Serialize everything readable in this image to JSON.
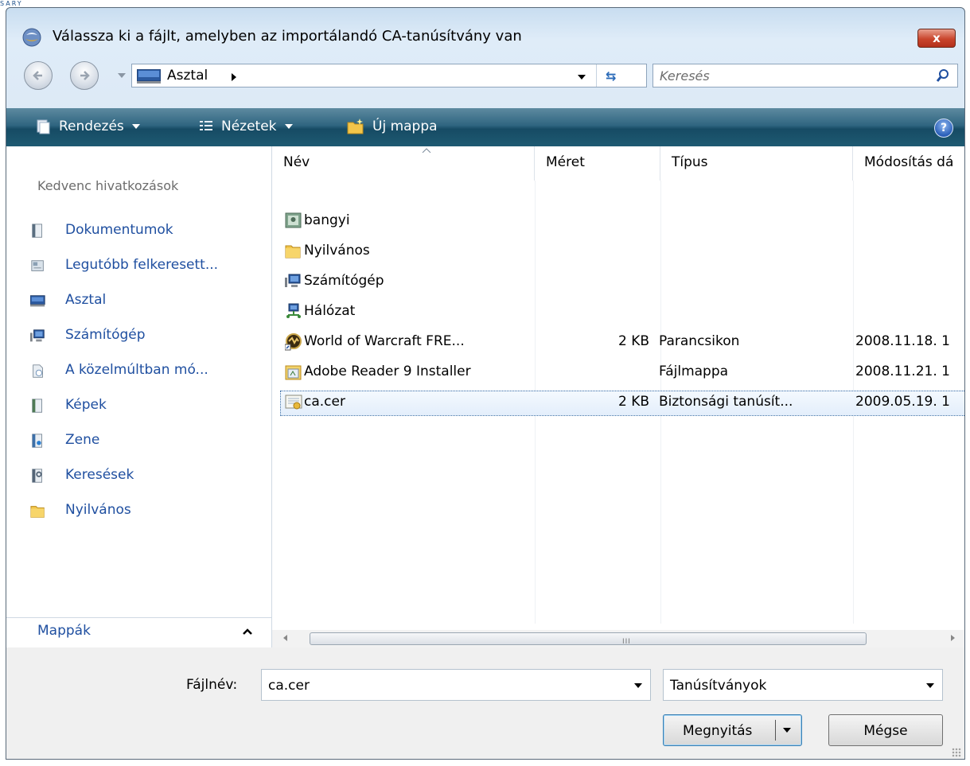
{
  "logo_fragment": "SARY",
  "window": {
    "title": "Válassza ki a fájlt, amelyben az importálandó CA-tanúsítvány van",
    "close_label": "x"
  },
  "address": {
    "crumb": "Asztal",
    "search_placeholder": "Keresés"
  },
  "toolbar": {
    "organize_label": "Rendezés",
    "views_label": "Nézetek",
    "new_folder_label": "Új mappa",
    "help_label": "?"
  },
  "nav": {
    "heading": "Kedvenc hivatkozások",
    "items": [
      {
        "label": "Dokumentumok",
        "icon": "documents-icon"
      },
      {
        "label": "Legutóbb felkeresett...",
        "icon": "recent-places-icon"
      },
      {
        "label": "Asztal",
        "icon": "desktop-icon"
      },
      {
        "label": "Számítógép",
        "icon": "computer-icon"
      },
      {
        "label": "A közelmúltban mó...",
        "icon": "recently-changed-icon"
      },
      {
        "label": "Képek",
        "icon": "pictures-icon"
      },
      {
        "label": "Zene",
        "icon": "music-icon"
      },
      {
        "label": "Keresések",
        "icon": "searches-icon"
      },
      {
        "label": "Nyilvános",
        "icon": "public-folder-icon"
      }
    ],
    "folders_label": "Mappák"
  },
  "columns": {
    "name": "Név",
    "size": "Méret",
    "type": "Típus",
    "modified": "Módosítás dá"
  },
  "files": [
    {
      "name": "bangyi",
      "size": "",
      "type": "",
      "modified": "",
      "icon": "user-folder-icon"
    },
    {
      "name": "Nyilvános",
      "size": "",
      "type": "",
      "modified": "",
      "icon": "folder-icon"
    },
    {
      "name": "Számítógép",
      "size": "",
      "type": "",
      "modified": "",
      "icon": "computer-icon"
    },
    {
      "name": "Hálózat",
      "size": "",
      "type": "",
      "modified": "",
      "icon": "network-icon"
    },
    {
      "name": "World of Warcraft FRE...",
      "size": "2 KB",
      "type": "Parancsikon",
      "modified": "2008.11.18. 1",
      "icon": "wow-shortcut-icon"
    },
    {
      "name": "Adobe Reader 9 Installer",
      "size": "",
      "type": "Fájlmappa",
      "modified": "2008.11.21. 1",
      "icon": "installer-folder-icon"
    },
    {
      "name": "ca.cer",
      "size": "2 KB",
      "type": "Biztonsági tanúsít...",
      "modified": "2009.05.19. 1",
      "icon": "certificate-icon",
      "selected": true
    }
  ],
  "scrollbar": {
    "grip": "III"
  },
  "bottom": {
    "filename_label": "Fájlnév:",
    "filename_value": "ca.cer",
    "filetype_value": "Tanúsítványok",
    "open_label": "Megnyitás",
    "cancel_label": "Mégse"
  },
  "colors": {
    "toolbar": "#1e5a72",
    "link": "#1f4fa0",
    "close": "#c9452c"
  }
}
